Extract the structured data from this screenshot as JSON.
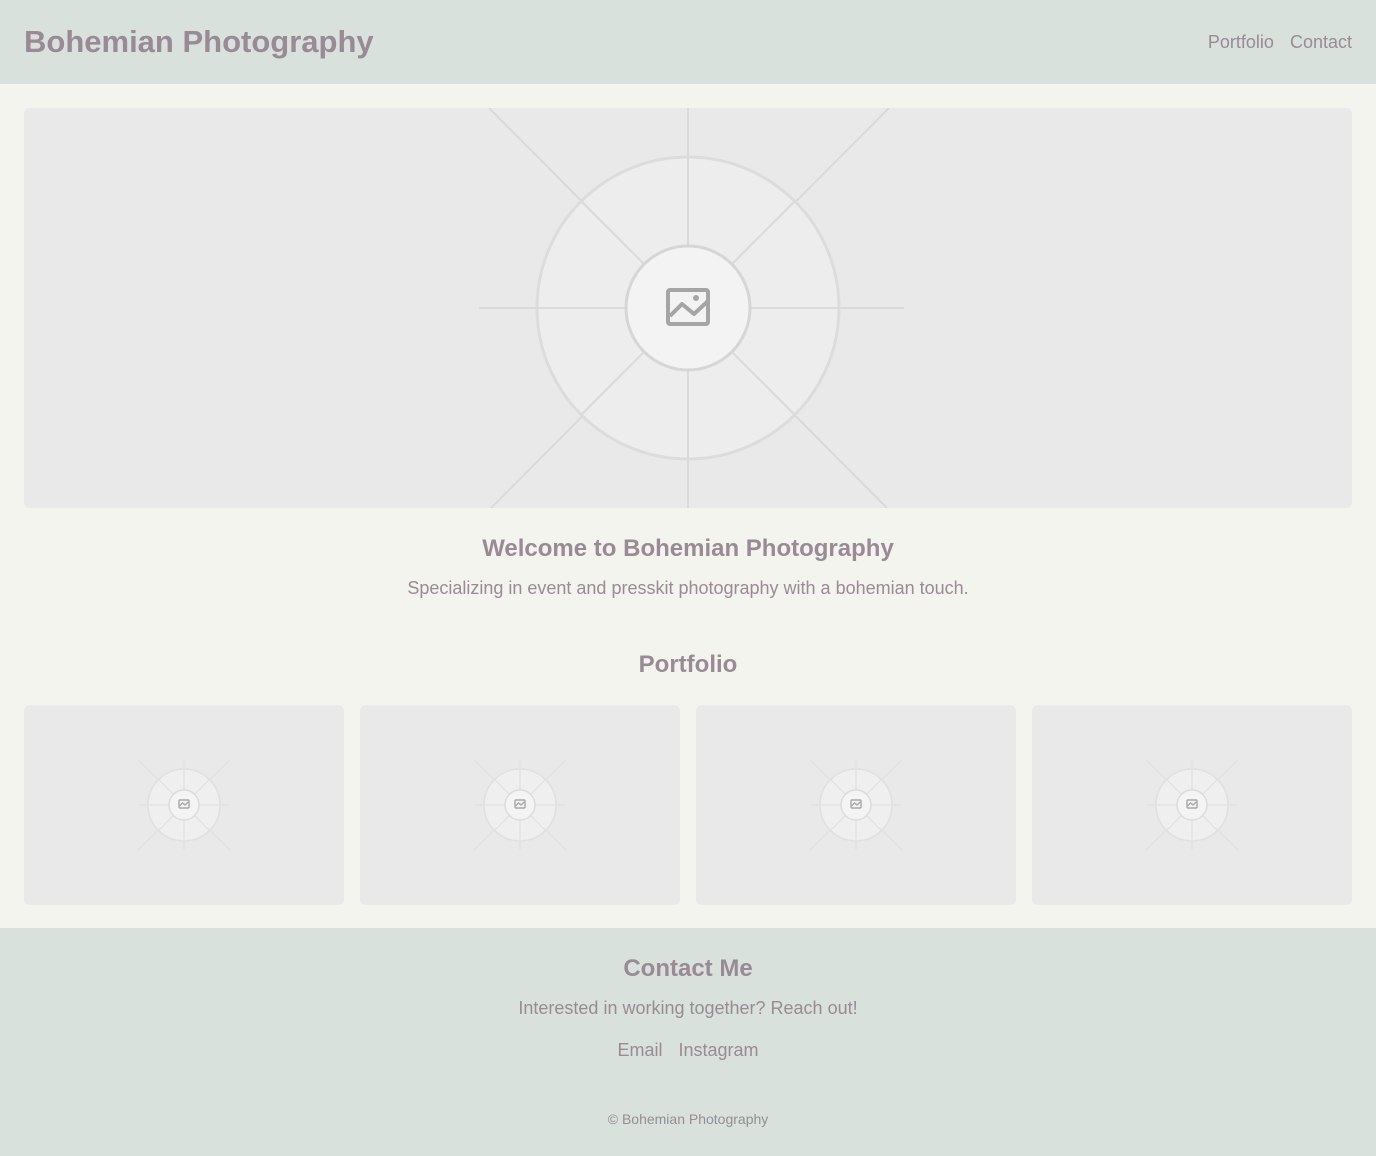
{
  "header": {
    "brand": "Bohemian Photography",
    "nav": [
      "Portfolio",
      "Contact"
    ]
  },
  "hero": {
    "image_icon": "image-placeholder-icon"
  },
  "welcome": {
    "title": "Welcome to Bohemian Photography",
    "text": "Specializing in event and presskit photography with a bohemian touch."
  },
  "portfolio": {
    "title": "Portfolio",
    "items": [
      {
        "icon": "image-placeholder-icon"
      },
      {
        "icon": "image-placeholder-icon"
      },
      {
        "icon": "image-placeholder-icon"
      },
      {
        "icon": "image-placeholder-icon"
      }
    ]
  },
  "contact": {
    "title": "Contact Me",
    "text": "Interested in working together? Reach out!",
    "links": [
      "Email",
      "Instagram"
    ]
  },
  "footer": {
    "copyright": "© Bohemian Photography"
  },
  "colors": {
    "background": "#f3f4ee",
    "header_bg": "#d8e1dc",
    "text": "#9a8a96",
    "placeholder_bg": "#e9e9e9"
  }
}
